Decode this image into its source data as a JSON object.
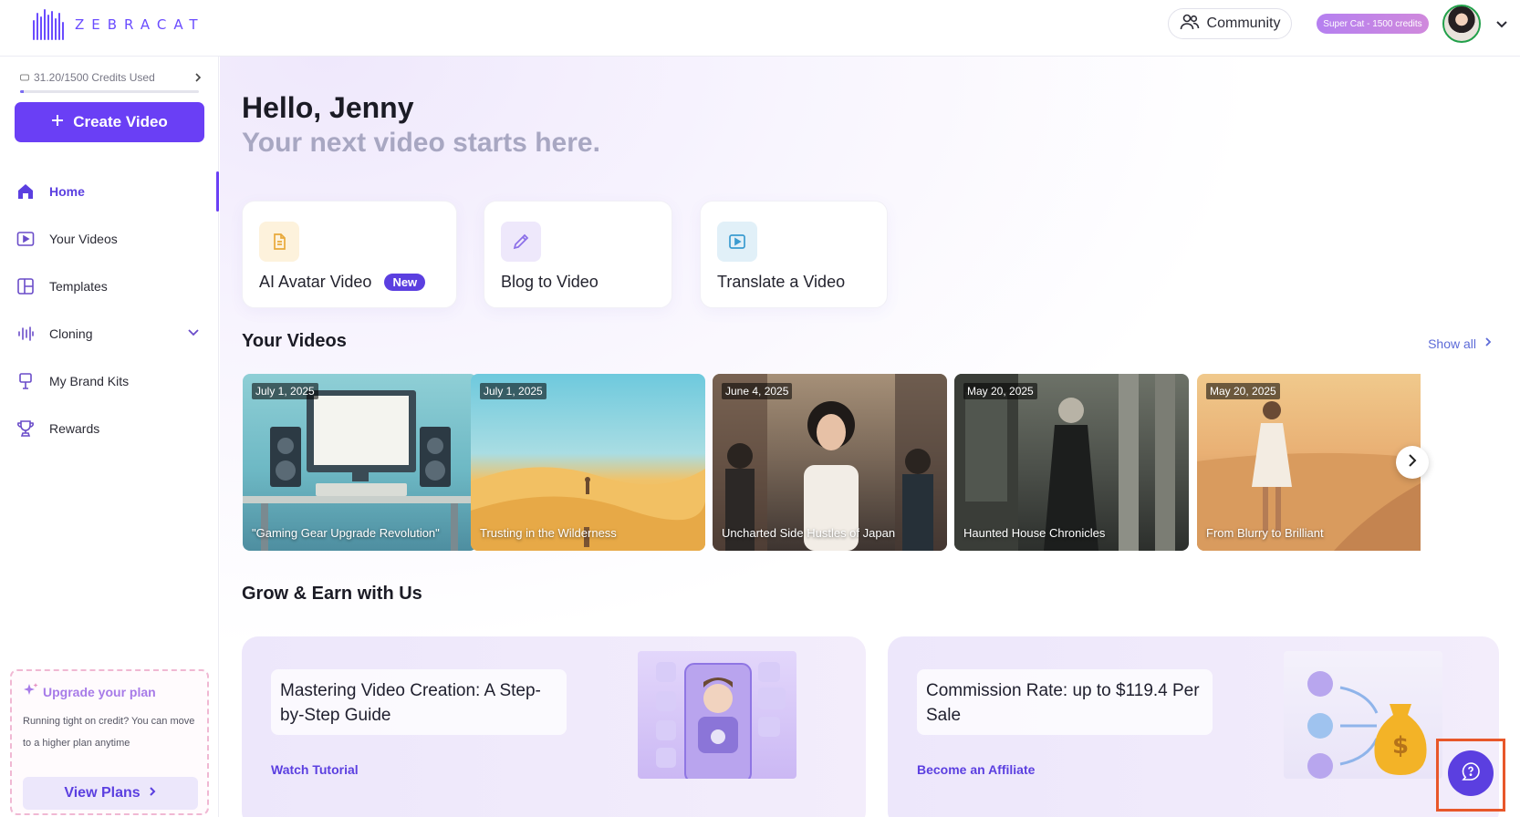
{
  "header": {
    "logo_text": "ZEBRACAT",
    "community_label": "Community",
    "plan_badge": "Super Cat - 1500 credits"
  },
  "sidebar": {
    "credits_text": "31.20/1500 Credits Used",
    "credits_used_fraction": 0.0208,
    "create_video_label": "Create Video",
    "items": [
      {
        "label": "Home",
        "icon": "home-icon",
        "active": true
      },
      {
        "label": "Your Videos",
        "icon": "video-play-icon"
      },
      {
        "label": "Templates",
        "icon": "layout-icon"
      },
      {
        "label": "Cloning",
        "icon": "waveform-icon"
      },
      {
        "label": "My Brand Kits",
        "icon": "paint-brush-icon"
      },
      {
        "label": "Rewards",
        "icon": "trophy-icon"
      }
    ],
    "upgrade": {
      "title": "Upgrade your plan",
      "text": "Running tight on credit? You can move to a higher plan anytime",
      "button": "View Plans"
    }
  },
  "main": {
    "greeting": "Hello, Jenny",
    "tagline": "Your next video starts here.",
    "actions": [
      {
        "label": "AI Avatar Video",
        "badge": "New",
        "icon": "document-icon",
        "accent": "#e8a93a"
      },
      {
        "label": "Blog to Video",
        "icon": "pencil-icon",
        "accent": "#8a6ee8"
      },
      {
        "label": "Translate a Video",
        "icon": "play-square-icon",
        "accent": "#3a9bd0"
      }
    ],
    "your_videos": {
      "title": "Your Videos",
      "show_all": "Show all",
      "videos": [
        {
          "date": "July 1, 2025",
          "title": "\"Gaming Gear Upgrade Revolution\""
        },
        {
          "date": "July 1, 2025",
          "title": "Trusting in the Wilderness"
        },
        {
          "date": "June 4, 2025",
          "title": "Uncharted Side Hustles of Japan"
        },
        {
          "date": "May 20, 2025",
          "title": "Haunted House Chronicles"
        },
        {
          "date": "May 20, 2025",
          "title": "From Blurry to Brilliant"
        }
      ]
    },
    "grow": {
      "title": "Grow & Earn with Us",
      "cards": [
        {
          "text": "Mastering Video Creation: A Step-by-Step Guide",
          "link": "Watch Tutorial"
        },
        {
          "text": "Commission Rate: up to $119.4 Per Sale",
          "link": "Become an Affiliate"
        }
      ]
    }
  },
  "colors": {
    "brand": "#6a3ff5",
    "link": "#5d6bd8",
    "highlight": "#e8572a"
  }
}
